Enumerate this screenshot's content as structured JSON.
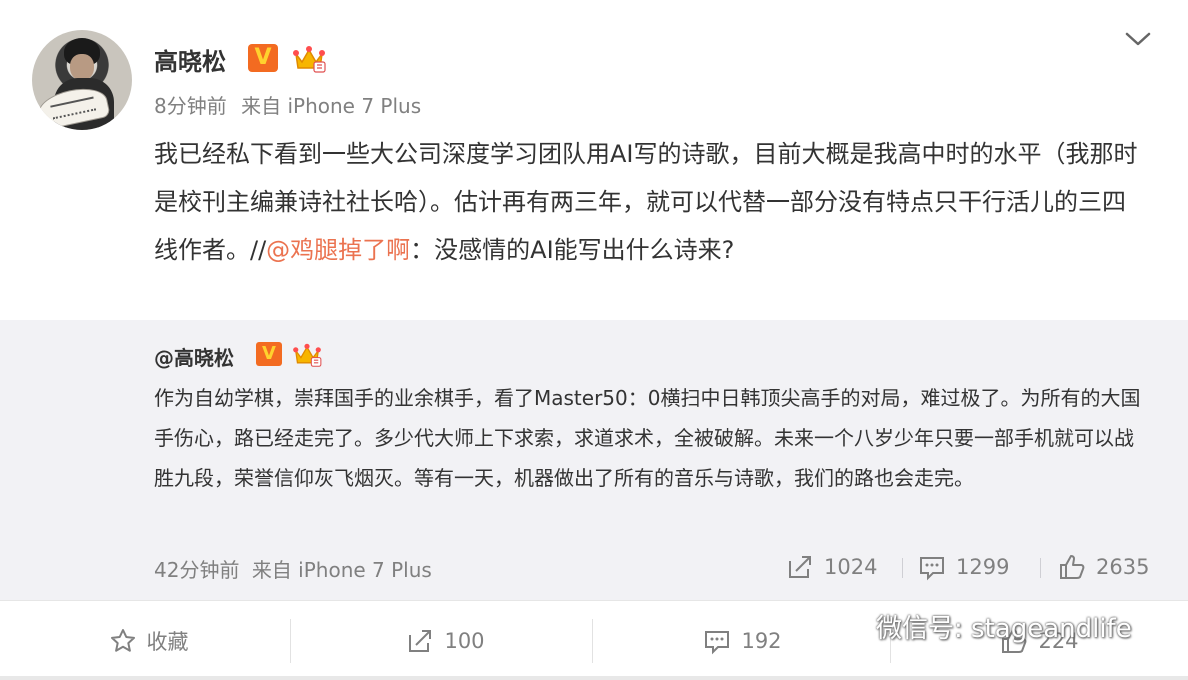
{
  "post": {
    "username": "高晓松",
    "vbadge": "V",
    "time": "8分钟前",
    "source": "来自 iPhone 7 Plus",
    "content_before": "我已经私下看到一些大公司深度学习团队用AI写的诗歌，目前大概是我高中时的水平（我那时是校刊主编兼诗社社长哈）。估计再有两三年，就可以代替一部分没有特点只干行活儿的三四线作者。//",
    "mention": "@鸡腿掉了啊",
    "content_after": "：没感情的AI能写出什么诗来?"
  },
  "repost": {
    "username": "@高晓松",
    "vbadge": "V",
    "text": "作为自幼学棋，崇拜国手的业余棋手，看了Master50：0横扫中日韩顶尖高手的对局，难过极了。为所有的大国手伤心，路已经走完了。多少代大师上下求索，求道求术，全被破解。未来一个八岁少年只要一部手机就可以战胜九段，荣誉信仰灰飞烟灭。等有一天，机器做出了所有的音乐与诗歌，我们的路也会走完。",
    "time": "42分钟前",
    "source": "来自 iPhone 7 Plus",
    "forwards": "1024",
    "comments": "1299",
    "likes": "2635"
  },
  "actions": {
    "favorite": "收藏",
    "forwards": "100",
    "comments": "192",
    "likes": "224"
  },
  "watermark": "微信号: stageandlife",
  "colors": {
    "mention": "#eb7350",
    "vbadge_bg": "#f36b21",
    "vbadge_fg": "#ffd22e",
    "repost_bg": "#f2f2f5",
    "meta": "#808080"
  }
}
